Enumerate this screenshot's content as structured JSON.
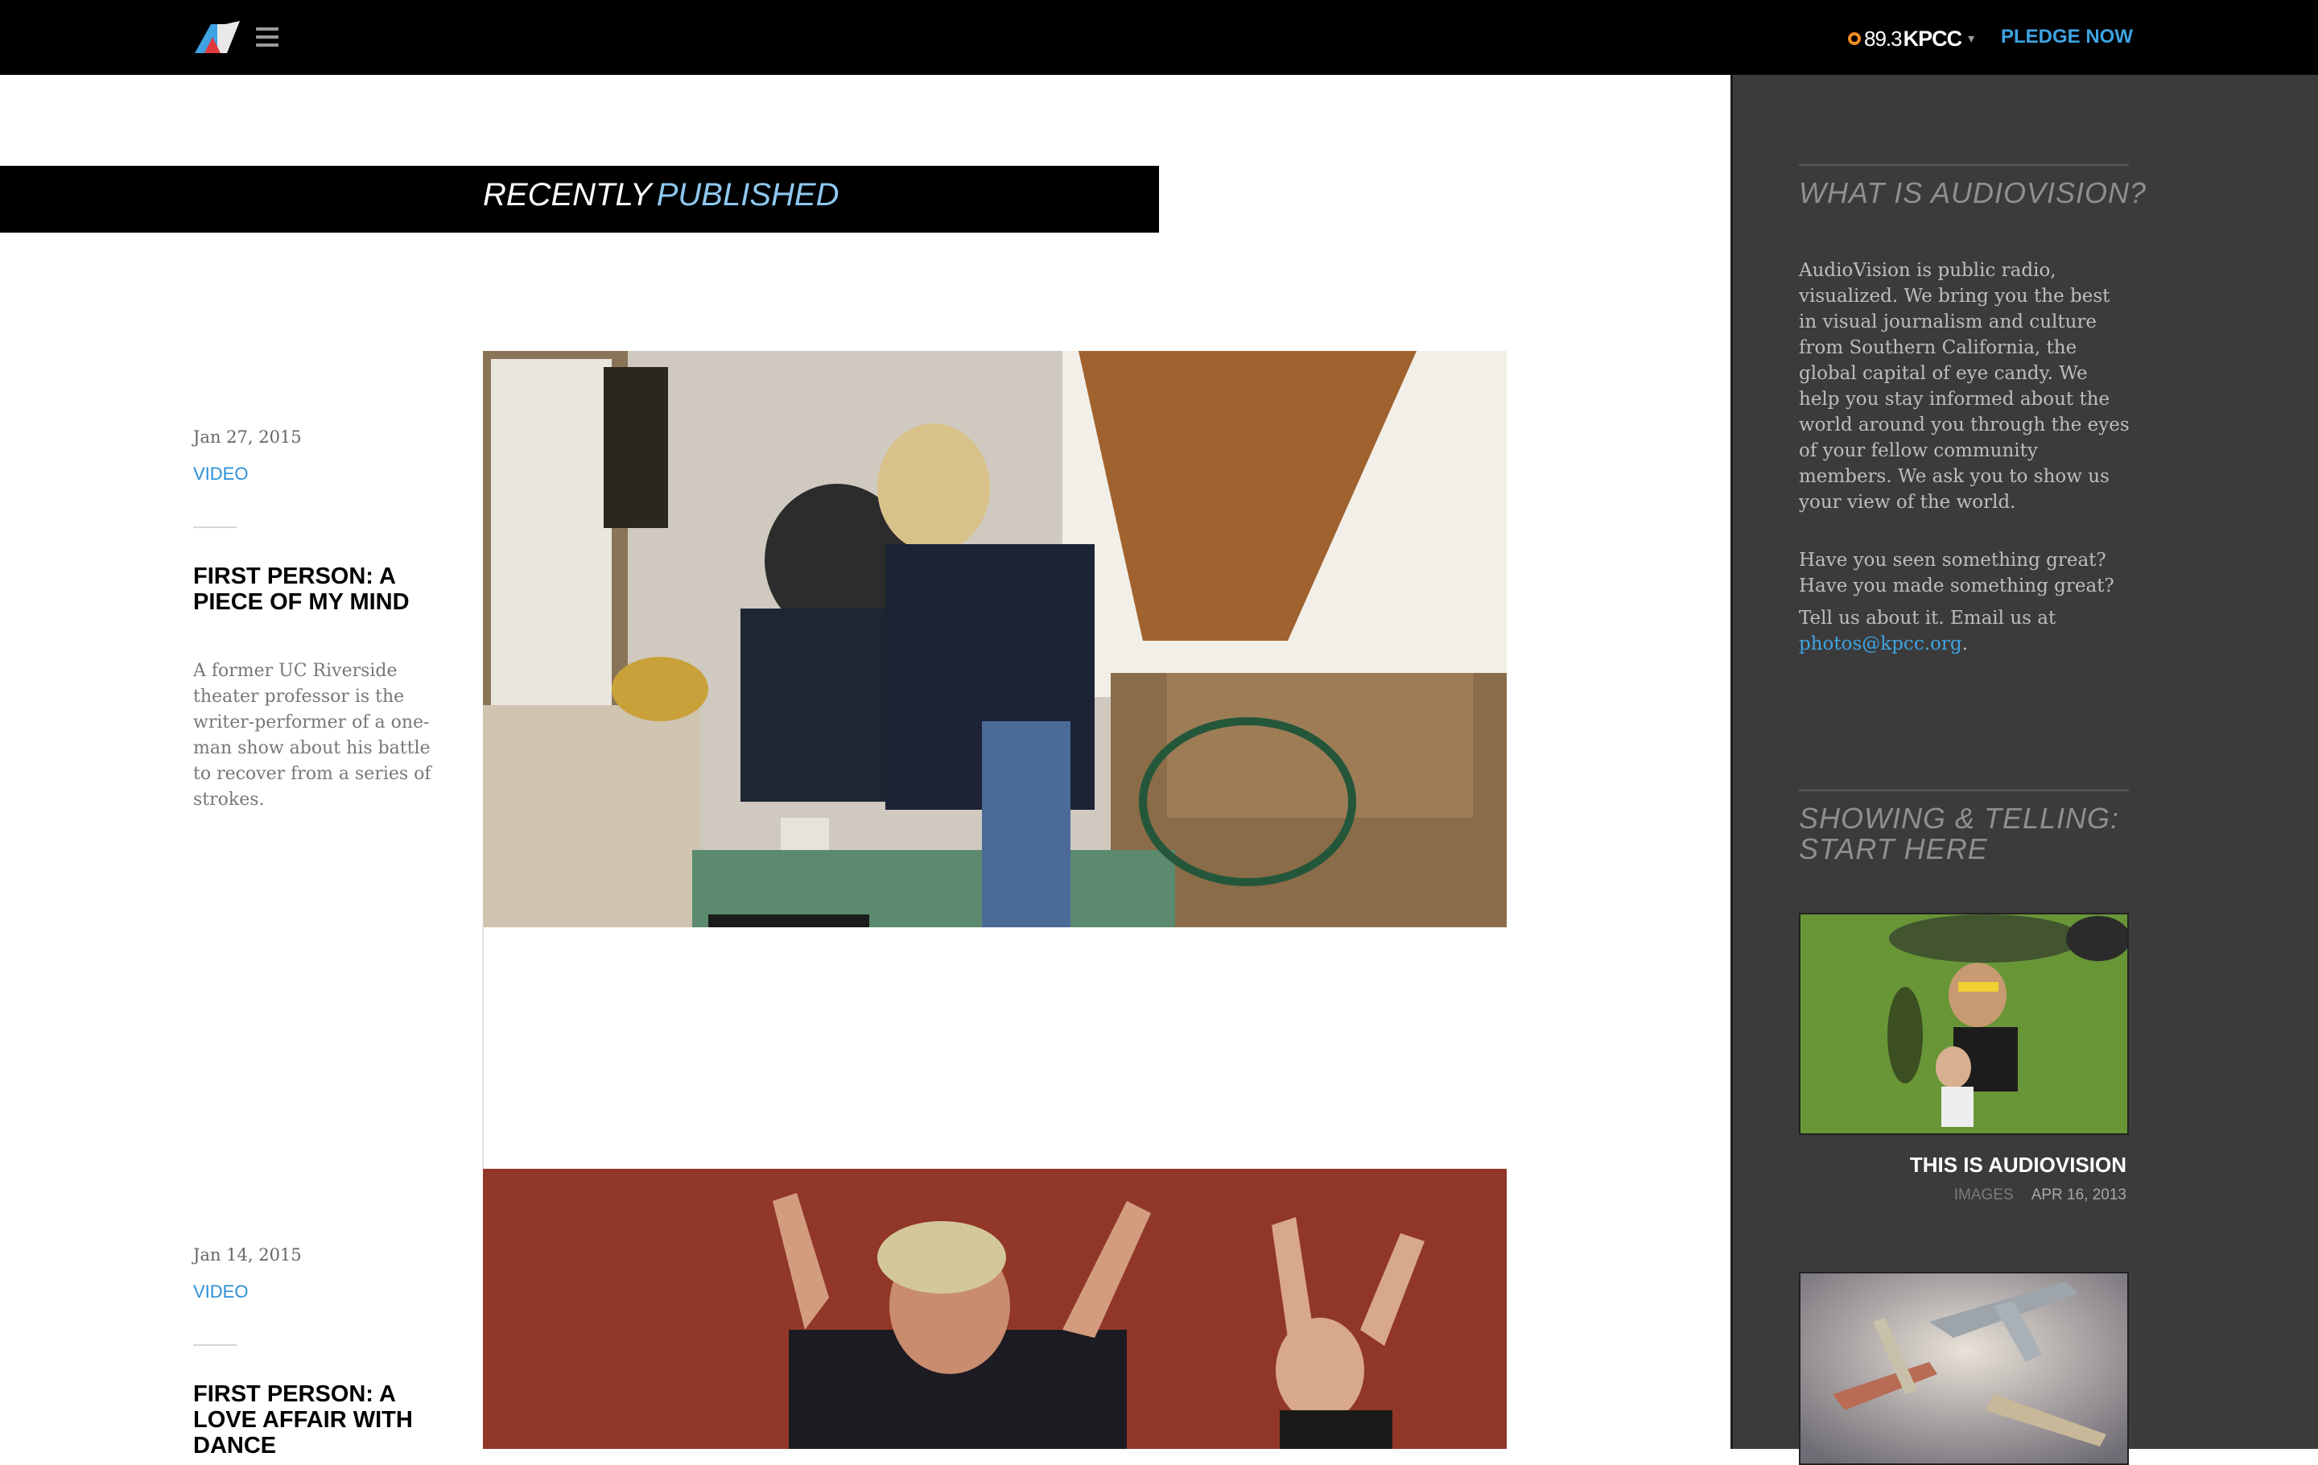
{
  "header": {
    "station_freq": "89.3",
    "station_call": "KPCC",
    "station_caret": "▾",
    "pledge_label": "PLEDGE NOW",
    "colors": {
      "background": "#000000",
      "pledge": "#3ea3e3",
      "station_dot": "#f08a24"
    }
  },
  "banner": {
    "word1": "RECENTLY",
    "word2": "PUBLISHED"
  },
  "posts": [
    {
      "date": "Jan 27, 2015",
      "category": "VIDEO",
      "title": "FIRST PERSON: A PIECE OF MY MIND",
      "excerpt": "A former UC Riverside theater professor is the writer-performer of a one-man show about his battle to recover from a series of strokes."
    },
    {
      "date": "Jan 14, 2015",
      "category": "VIDEO",
      "title": "FIRST PERSON: A LOVE AFFAIR WITH DANCE"
    }
  ],
  "sidebar": {
    "about_heading": "WHAT IS AUDIOVISION?",
    "about_p1": "AudioVision is public radio, visualized. We bring you the best in visual journalism and culture from Southern California, the global capital of eye candy. We help you stay informed about the world around you through the eyes of your fellow community members. We ask you to show us your view of the world.",
    "about_p2": "Have you seen something great? Have you made something great?",
    "about_p3": "Tell us about it. Email us at",
    "email": "photos@kpcc.org",
    "email_suffix": ".",
    "start_heading": "SHOWING & TELLING: START HERE",
    "items": [
      {
        "title": "THIS IS AUDIOVISION",
        "type": "IMAGES",
        "date": "APR 16, 2013"
      }
    ]
  }
}
